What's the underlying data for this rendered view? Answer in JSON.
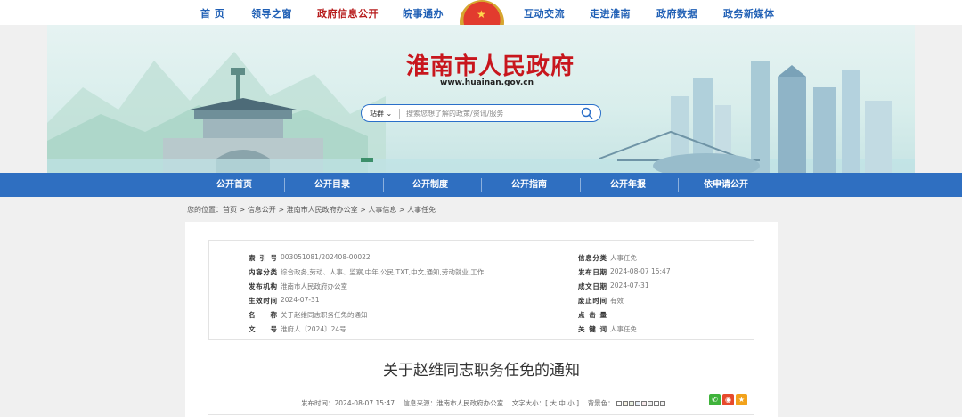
{
  "top_nav": {
    "items": [
      "首 页",
      "领导之窗",
      "政府信息公开",
      "皖事通办",
      "互动交流",
      "走进淮南",
      "政府数据",
      "政务新媒体"
    ],
    "active_index": 2
  },
  "banner": {
    "site_title": "淮南市人民政府",
    "site_url": "www.huainan.gov.cn"
  },
  "search": {
    "scope": "站群",
    "placeholder": "搜索您想了解的政策/资讯/服务"
  },
  "blue_nav": {
    "items": [
      "公开首页",
      "公开目录",
      "公开制度",
      "公开指南",
      "公开年报",
      "依申请公开"
    ]
  },
  "breadcrumb": "您的位置：首页 > 信息公开 > 淮南市人民政府办公室 > 人事信息 > 人事任免",
  "meta": {
    "left": [
      {
        "label": "索引号",
        "value": "003051081/202408-00022"
      },
      {
        "label": "内容分类",
        "value": "综合政务,劳动、人事、监察,中年,公民,TXT,中文,通知,劳动就业,工作"
      },
      {
        "label": "发布机构",
        "value": "淮南市人民政府办公室"
      },
      {
        "label": "生效时间",
        "value": "2024-07-31"
      },
      {
        "label": "名称",
        "value": "关于赵维同志职务任免的通知"
      },
      {
        "label": "文号",
        "value": "淮府人〔2024〕24号"
      }
    ],
    "right": [
      {
        "label": "信息分类",
        "value": "人事任免"
      },
      {
        "label": "发布日期",
        "value": "2024-08-07 15:47"
      },
      {
        "label": "成文日期",
        "value": "2024-07-31"
      },
      {
        "label": "废止时间",
        "value": "有效"
      },
      {
        "label": "点击量",
        "value": ""
      },
      {
        "label": "关键词",
        "value": "人事任免"
      }
    ]
  },
  "document": {
    "title": "关于赵维同志职务任免的通知",
    "publish_time": "发布时间：2024-08-07 15:47",
    "source": "信息来源：淮南市人民政府办公室",
    "font_size": "文字大小：[ 大 中 小 ]",
    "bg_color": "背景色："
  },
  "colors": {
    "nav_blue": "#2f6fc1",
    "title_red": "#c8161d",
    "active_red": "#b71c1c",
    "link_blue": "#1f5fb5"
  },
  "icons": [
    "national-emblem-icon",
    "search-icon",
    "chevron-down-icon",
    "wechat-icon",
    "weibo-icon",
    "favorite-icon"
  ]
}
